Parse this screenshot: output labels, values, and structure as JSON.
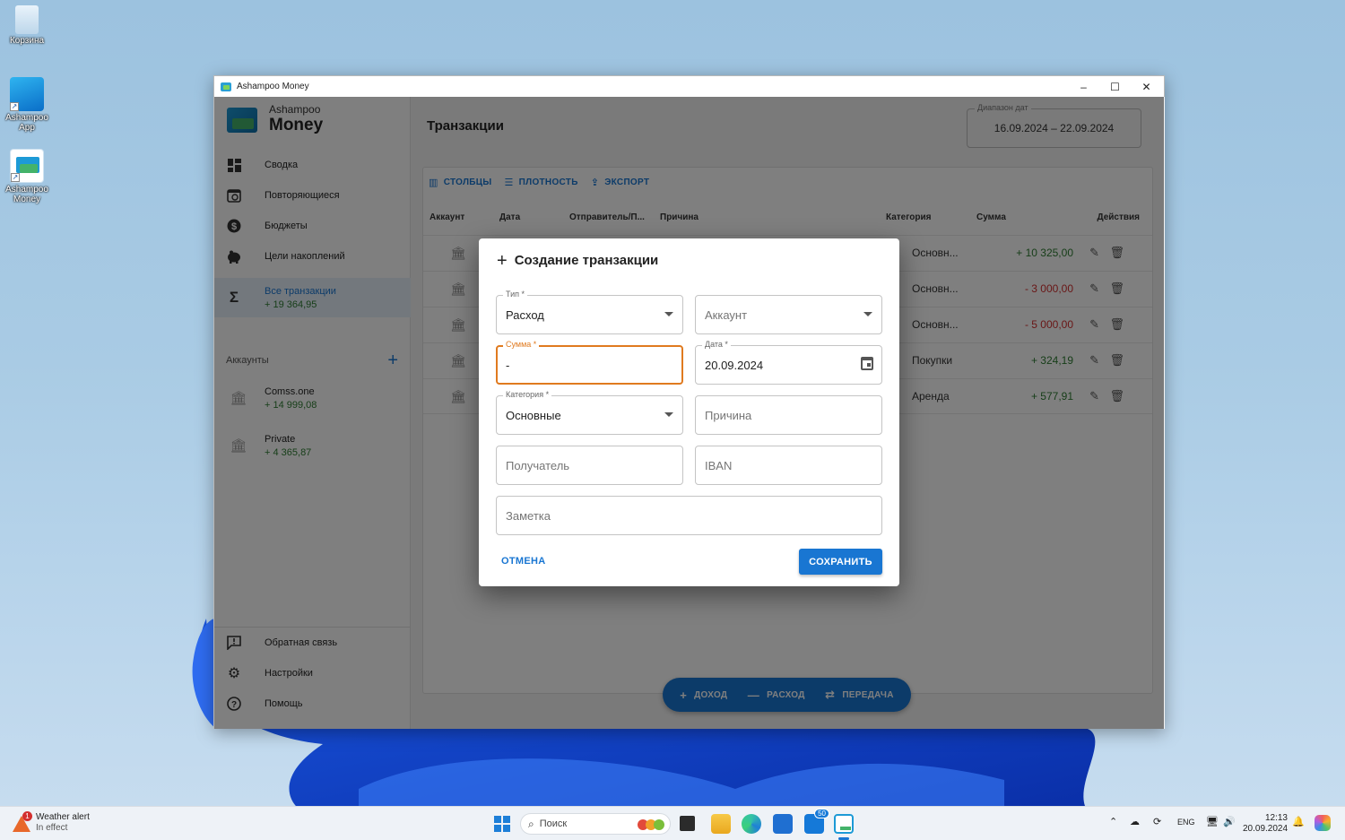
{
  "desktop": {
    "icons": [
      {
        "label": "Корзина"
      },
      {
        "label": "Ashampoo App"
      },
      {
        "label": "Ashampoo Money"
      }
    ]
  },
  "window": {
    "title": "Ashampoo Money",
    "controls": {
      "minimize": "–",
      "maximize": "☐",
      "close": "✕"
    }
  },
  "brand": {
    "small": "Ashampoo",
    "big": "Money"
  },
  "nav": {
    "items": [
      {
        "label": "Сводка",
        "icon": "dashboard-icon"
      },
      {
        "label": "Повторяющиеся",
        "icon": "calendar-repeat-icon"
      },
      {
        "label": "Бюджеты",
        "icon": "dollar-icon"
      },
      {
        "label": "Цели накоплений",
        "icon": "piggy-bank-icon"
      }
    ],
    "active": {
      "label": "Все транзакции",
      "sub": "+ 19 364,95",
      "icon": "sigma-icon"
    },
    "accounts_header": "Аккаунты",
    "accounts": [
      {
        "name": "Comss.one",
        "value": "+ 14 999,08"
      },
      {
        "name": "Private",
        "value": "+ 4 365,87"
      }
    ],
    "bottom": [
      {
        "label": "Обратная связь",
        "icon": "feedback-icon"
      },
      {
        "label": "Настройки",
        "icon": "gear-icon"
      },
      {
        "label": "Помощь",
        "icon": "help-icon"
      }
    ]
  },
  "main": {
    "title": "Транзакции",
    "date_range": {
      "label": "Диапазон дат",
      "value": "16.09.2024 – 22.09.2024"
    },
    "toolbar": {
      "columns": "СТОЛБЦЫ",
      "density": "ПЛОТНОСТЬ",
      "export": "ЭКСПОРТ"
    },
    "columns": [
      "Аккаунт",
      "Дата",
      "Отправитель/П...",
      "Причина",
      "Категория",
      "Сумма",
      "Действия"
    ],
    "rows": [
      {
        "category": "Основн...",
        "amount": "+ 10 325,00",
        "sign": "pos"
      },
      {
        "category": "Основн...",
        "amount": "- 3 000,00",
        "sign": "neg"
      },
      {
        "category": "Основн...",
        "amount": "- 5 000,00",
        "sign": "neg"
      },
      {
        "category": "Покупки",
        "amount": "+ 324,19",
        "sign": "pos"
      },
      {
        "category": "Аренда",
        "amount": "+ 577,91",
        "sign": "pos"
      }
    ],
    "fab": {
      "income": "ДОХОД",
      "expense": "РАСХОД",
      "transfer": "ПЕРЕДАЧА"
    }
  },
  "dialog": {
    "title": "Создание транзакции",
    "type": {
      "label": "Тип *",
      "value": "Расход"
    },
    "account": {
      "placeholder": "Аккаунт"
    },
    "amount": {
      "label": "Сумма *",
      "value": "-"
    },
    "date": {
      "label": "Дата *",
      "value": "20.09.2024"
    },
    "category": {
      "label": "Категория *",
      "value": "Основные"
    },
    "reason": {
      "placeholder": "Причина"
    },
    "recipient": {
      "placeholder": "Получатель"
    },
    "iban": {
      "placeholder": "IBAN"
    },
    "note": {
      "placeholder": "Заметка"
    },
    "cancel": "ОТМЕНА",
    "save": "СОХРАНИТЬ"
  },
  "taskbar": {
    "weather": {
      "title": "Weather alert",
      "sub": "In effect"
    },
    "search": "Поиск",
    "badge": "50",
    "lang": "ENG",
    "time": "12:13",
    "date": "20.09.2024"
  }
}
